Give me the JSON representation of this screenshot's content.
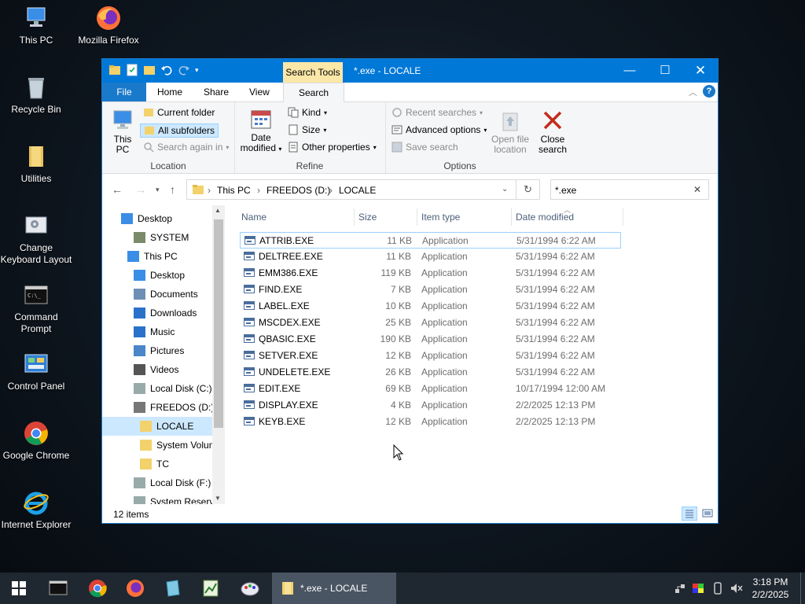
{
  "desktop": {
    "icons": [
      {
        "label": "This PC"
      },
      {
        "label": "Mozilla Firefox"
      },
      {
        "label": "Recycle Bin"
      },
      {
        "label": "Utilities"
      },
      {
        "label": "Change Keyboard Layout"
      },
      {
        "label": "Command Prompt"
      },
      {
        "label": "Control Panel"
      },
      {
        "label": "Google Chrome"
      },
      {
        "label": "Internet Explorer"
      }
    ]
  },
  "window": {
    "context_tab": "Search Tools",
    "title": "*.exe - LOCALE",
    "tabs": [
      "File",
      "Home",
      "Share",
      "View",
      "Search"
    ],
    "ribbon": {
      "location": {
        "label": "Location",
        "this_pc": "This PC",
        "current_folder": "Current folder",
        "all_subfolders": "All subfolders",
        "search_again_in": "Search again in"
      },
      "refine": {
        "label": "Refine",
        "date_modified": "Date modified",
        "kind": "Kind",
        "size": "Size",
        "other_properties": "Other properties"
      },
      "options": {
        "label": "Options",
        "recent_searches": "Recent searches",
        "advanced_options": "Advanced options",
        "save_search": "Save search",
        "open_file_location": "Open file location",
        "close_search": "Close search"
      }
    },
    "address": {
      "crumbs": [
        "This PC",
        "FREEDOS (D:)",
        "LOCALE"
      ],
      "search_value": "*.exe"
    },
    "nav": [
      {
        "label": "Desktop",
        "icon": "desktop-icon"
      },
      {
        "label": "SYSTEM",
        "icon": "user-icon"
      },
      {
        "label": "This PC",
        "icon": "computer-icon"
      },
      {
        "label": "Desktop",
        "icon": "desktop-icon"
      },
      {
        "label": "Documents",
        "icon": "documents-icon"
      },
      {
        "label": "Downloads",
        "icon": "downloads-icon"
      },
      {
        "label": "Music",
        "icon": "music-icon"
      },
      {
        "label": "Pictures",
        "icon": "pictures-icon"
      },
      {
        "label": "Videos",
        "icon": "videos-icon"
      },
      {
        "label": "Local Disk (C:)",
        "icon": "drive-icon"
      },
      {
        "label": "FREEDOS (D:)",
        "icon": "usb-drive-icon"
      },
      {
        "label": "LOCALE",
        "icon": "folder-icon"
      },
      {
        "label": "System Volun",
        "icon": "folder-icon"
      },
      {
        "label": "TC",
        "icon": "folder-icon"
      },
      {
        "label": "Local Disk (F:)",
        "icon": "drive-icon"
      },
      {
        "label": "System Reserv",
        "icon": "drive-icon"
      }
    ],
    "columns": {
      "name": "Name",
      "size": "Size",
      "type": "Item type",
      "date": "Date modified"
    },
    "files": [
      {
        "name": "ATTRIB.EXE",
        "size": "11 KB",
        "type": "Application",
        "date": "5/31/1994 6:22 AM"
      },
      {
        "name": "DELTREE.EXE",
        "size": "11 KB",
        "type": "Application",
        "date": "5/31/1994 6:22 AM"
      },
      {
        "name": "EMM386.EXE",
        "size": "119 KB",
        "type": "Application",
        "date": "5/31/1994 6:22 AM"
      },
      {
        "name": "FIND.EXE",
        "size": "7 KB",
        "type": "Application",
        "date": "5/31/1994 6:22 AM"
      },
      {
        "name": "LABEL.EXE",
        "size": "10 KB",
        "type": "Application",
        "date": "5/31/1994 6:22 AM"
      },
      {
        "name": "MSCDEX.EXE",
        "size": "25 KB",
        "type": "Application",
        "date": "5/31/1994 6:22 AM"
      },
      {
        "name": "QBASIC.EXE",
        "size": "190 KB",
        "type": "Application",
        "date": "5/31/1994 6:22 AM"
      },
      {
        "name": "SETVER.EXE",
        "size": "12 KB",
        "type": "Application",
        "date": "5/31/1994 6:22 AM"
      },
      {
        "name": "UNDELETE.EXE",
        "size": "26 KB",
        "type": "Application",
        "date": "5/31/1994 6:22 AM"
      },
      {
        "name": "EDIT.EXE",
        "size": "69 KB",
        "type": "Application",
        "date": "10/17/1994 12:00 AM"
      },
      {
        "name": "DISPLAY.EXE",
        "size": "4 KB",
        "type": "Application",
        "date": "2/2/2025 12:13 PM"
      },
      {
        "name": "KEYB.EXE",
        "size": "12 KB",
        "type": "Application",
        "date": "2/2/2025 12:13 PM"
      }
    ],
    "status": "12 items"
  },
  "taskbar": {
    "active_window": "*.exe - LOCALE",
    "time": "3:18 PM",
    "date": "2/2/2025"
  },
  "colors": {
    "accent": "#0078d7",
    "context_tab": "#fbe7a8",
    "selection": "#cce8ff",
    "close_x": "#c42b1c"
  }
}
